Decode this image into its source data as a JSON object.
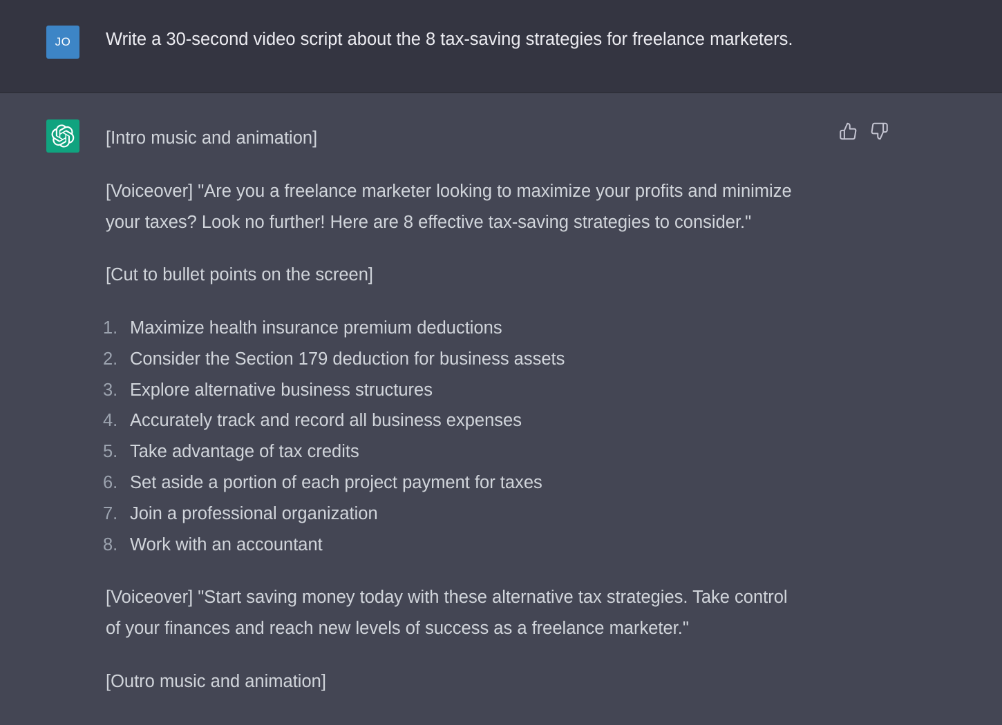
{
  "user_message": {
    "avatar_initials": "JO",
    "text": "Write a 30-second video script about the 8 tax-saving strategies for freelance marketers."
  },
  "assistant_message": {
    "avatar_icon": "openai-logo-icon",
    "intro": "[Intro music and animation]",
    "voiceover_1_line1": "[Voiceover] \"Are you a freelance marketer looking to maximize your profits and minimize",
    "voiceover_1_line2": "your taxes? Look no further! Here are 8 effective tax-saving strategies to consider.\"",
    "cut": "[Cut to bullet points on the screen]",
    "strategies": [
      {
        "num": "1.",
        "text": "Maximize health insurance premium deductions"
      },
      {
        "num": "2.",
        "text": "Consider the Section 179 deduction for business assets"
      },
      {
        "num": "3.",
        "text": "Explore alternative business structures"
      },
      {
        "num": "4.",
        "text": "Accurately track and record all business expenses"
      },
      {
        "num": "5.",
        "text": "Take advantage of tax credits"
      },
      {
        "num": "6.",
        "text": "Set aside a portion of each project payment for taxes"
      },
      {
        "num": "7.",
        "text": "Join a professional organization"
      },
      {
        "num": "8.",
        "text": "Work with an accountant"
      }
    ],
    "voiceover_2_line1": "[Voiceover] \"Start saving money today with these alternative tax strategies. Take control",
    "voiceover_2_line2": "of your finances and reach new levels of success as a freelance marketer.\"",
    "outro": "[Outro music and animation]"
  },
  "feedback": {
    "thumbs_up_icon": "thumbs-up-icon",
    "thumbs_down_icon": "thumbs-down-icon"
  },
  "colors": {
    "user_bg": "#343541",
    "assistant_bg": "#444654",
    "user_avatar": "#3d85c6",
    "bot_avatar": "#10a37f"
  }
}
